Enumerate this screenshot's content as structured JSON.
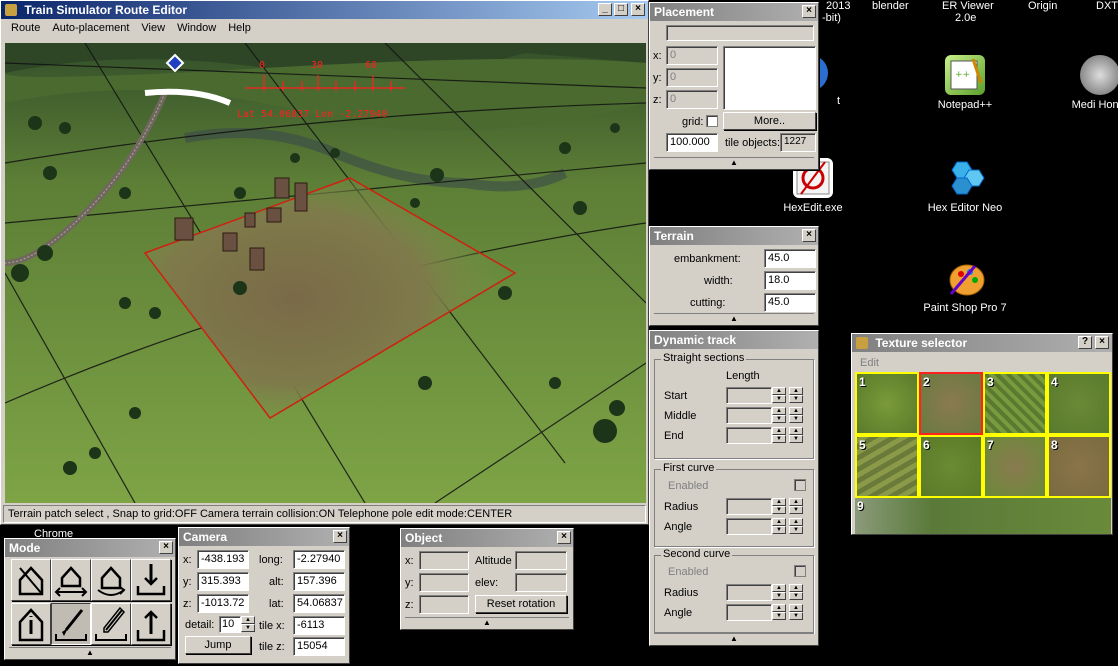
{
  "desktop": {
    "top_labels": [
      "2013",
      "-bit)",
      "blender",
      "ER Viewer",
      "2.0e",
      "Origin",
      "DXT"
    ],
    "icons": [
      {
        "label": "Notepad++",
        "icon": "notepad-plus-plus-icon"
      },
      {
        "label": "Medi Honor",
        "icon": "medal-of-honor-icon"
      },
      {
        "label": "HexEdit.exe",
        "icon": "hexedit-icon"
      },
      {
        "label": "Hex Editor Neo",
        "icon": "hex-editor-neo-icon"
      },
      {
        "label": "Paint Shop Pro 7",
        "icon": "paint-shop-pro-icon"
      },
      {
        "label": "Chrome",
        "icon": "chrome-icon"
      },
      {
        "label": "t",
        "icon": "shortcut-icon"
      }
    ]
  },
  "main_window": {
    "title": "Train Simulator Route Editor",
    "menu": [
      "Route",
      "Auto-placement",
      "View",
      "Window",
      "Help"
    ],
    "compass_ticks": [
      "0",
      "30",
      "60"
    ],
    "coords_overlay": "Lat 54.06837 Lon -2.27940",
    "status": "Terrain patch select , Snap to grid:OFF Camera terrain collision:ON Telephone pole edit mode:CENTER"
  },
  "placement": {
    "title": "Placement",
    "x_label": "x:",
    "x": "0",
    "y_label": "y:",
    "y": "0",
    "z_label": "z:",
    "z": "0",
    "grid_label": "grid:",
    "more_button": "More..",
    "scale": "100.000",
    "tile_objects_label": "tile objects:",
    "tile_objects": "1227"
  },
  "terrain": {
    "title": "Terrain",
    "embankment_label": "embankment:",
    "embankment": "45.0",
    "width_label": "width:",
    "width": "18.0",
    "cutting_label": "cutting:",
    "cutting": "45.0"
  },
  "dynamic_track": {
    "title": "Dynamic track",
    "straight_title": "Straight sections",
    "length_header": "Length",
    "start": "Start",
    "middle": "Middle",
    "end": "End",
    "first_curve": "First curve",
    "second_curve": "Second curve",
    "enabled": "Enabled",
    "radius": "Radius",
    "angle": "Angle"
  },
  "texture_selector": {
    "title": "Texture selector",
    "menu": "Edit",
    "help": "?",
    "tiles": [
      "1",
      "2",
      "3",
      "4",
      "5",
      "6",
      "7",
      "8",
      "9"
    ],
    "selected": "2"
  },
  "mode": {
    "title": "Mode"
  },
  "camera": {
    "title": "Camera",
    "x_label": "x:",
    "x": "-438.193",
    "y_label": "y:",
    "y": "315.393",
    "z_label": "z:",
    "z": "-1013.72",
    "long_label": "long:",
    "long": "-2.27940",
    "alt_label": "alt:",
    "alt": "157.396",
    "lat_label": "lat:",
    "lat": "54.06837",
    "detail_label": "detail:",
    "detail": "10",
    "tilex_label": "tile x:",
    "tilex": "-6113",
    "tilez_label": "tile z:",
    "tilez": "15054",
    "jump_button": "Jump"
  },
  "object": {
    "title": "Object",
    "x_label": "x:",
    "y_label": "y:",
    "z_label": "z:",
    "altitude_label": "Altitude",
    "elev_label": "elev:",
    "reset_button": "Reset rotation"
  },
  "colors": {
    "title_active": "#0a246a",
    "title_inactive": "#808080",
    "selection": "#ff0000",
    "texture_border": "#ffff00",
    "overlay_text": "#ff2020"
  }
}
